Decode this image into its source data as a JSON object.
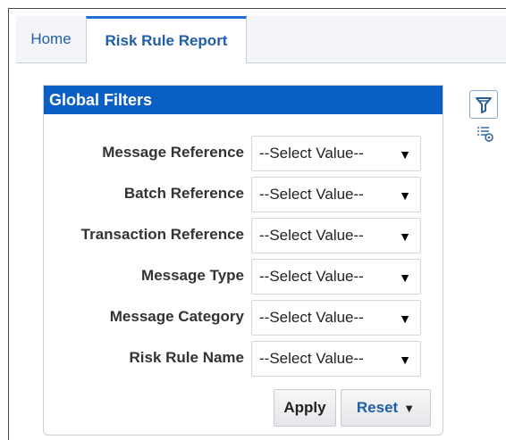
{
  "tabs": {
    "home": "Home",
    "risk_rule_report": "Risk Rule Report"
  },
  "panel": {
    "title": "Global Filters"
  },
  "filters": [
    {
      "label": "Message Reference",
      "value": "--Select Value--"
    },
    {
      "label": "Batch Reference",
      "value": "--Select Value--"
    },
    {
      "label": "Transaction Reference",
      "value": "--Select Value--"
    },
    {
      "label": "Message Type",
      "value": "--Select Value--"
    },
    {
      "label": "Message Category",
      "value": "--Select Value--"
    },
    {
      "label": "Risk Rule Name",
      "value": "--Select Value--"
    }
  ],
  "buttons": {
    "apply": "Apply",
    "reset": "Reset"
  },
  "icons": {
    "filter": "filter-icon",
    "list": "list-settings-icon",
    "caret": "caret-down-icon"
  },
  "colors": {
    "accent": "#0a5fc4",
    "link": "#1f5ea8"
  }
}
